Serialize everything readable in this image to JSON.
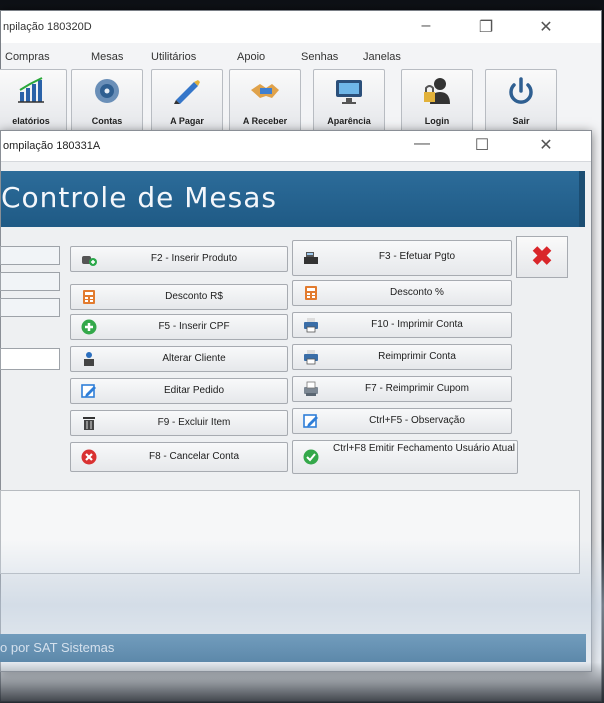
{
  "main_window": {
    "title": "npilação 180320D",
    "controls": {
      "minimize": "–",
      "maximize": "❐",
      "close": "✕"
    }
  },
  "menu": {
    "items": [
      "Compras",
      "Mesas",
      "Utilitários",
      "Apoio",
      "Senhas",
      "Janelas"
    ]
  },
  "toolbar": {
    "buttons": [
      {
        "label": "elatórios",
        "icon": "chart-icon"
      },
      {
        "label": "Contas",
        "icon": "disc-icon"
      },
      {
        "label": "A Pagar",
        "icon": "pen-icon"
      },
      {
        "label": "A Receber",
        "icon": "handshake-icon"
      },
      {
        "label": "Aparência",
        "icon": "monitor-icon"
      },
      {
        "label": "Login",
        "icon": "user-lock-icon"
      },
      {
        "label": "Sair",
        "icon": "power-icon"
      }
    ]
  },
  "child_window": {
    "title": "ompilação 180331A",
    "controls": {
      "minimize": "—",
      "maximize": "☐",
      "close": "✕"
    },
    "banner_title": "Controle de Mesas",
    "actions_left": [
      {
        "label": "F2 - Inserir Produto",
        "icon": "add-product-icon"
      },
      {
        "label": "Desconto R$",
        "icon": "discount-icon"
      },
      {
        "label": "F5 - Inserir CPF",
        "icon": "plus-circle-icon"
      },
      {
        "label": "Alterar Cliente",
        "icon": "client-icon"
      },
      {
        "label": "Editar Pedido",
        "icon": "edit-icon"
      },
      {
        "label": "F9 - Excluir Item",
        "icon": "trash-icon"
      },
      {
        "label": "F8 - Cancelar Conta",
        "icon": "cancel-icon"
      }
    ],
    "actions_right": [
      {
        "label": "F3 - Efetuar Pgto",
        "icon": "cash-register-icon"
      },
      {
        "label": "Desconto %",
        "icon": "discount-icon"
      },
      {
        "label": "F10 - Imprimir Conta",
        "icon": "printer-icon"
      },
      {
        "label": "Reimprimir Conta",
        "icon": "printer-icon"
      },
      {
        "label": "F7 - Reimprimir Cupom",
        "icon": "receipt-printer-icon"
      },
      {
        "label": "Ctrl+F5 - Observação",
        "icon": "edit-icon"
      },
      {
        "label": "Ctrl+F8 Emitir Fechamento Usuário Atual",
        "icon": "check-circle-icon"
      }
    ],
    "close_action": "✖",
    "status_text": "o por SAT Sistemas"
  }
}
